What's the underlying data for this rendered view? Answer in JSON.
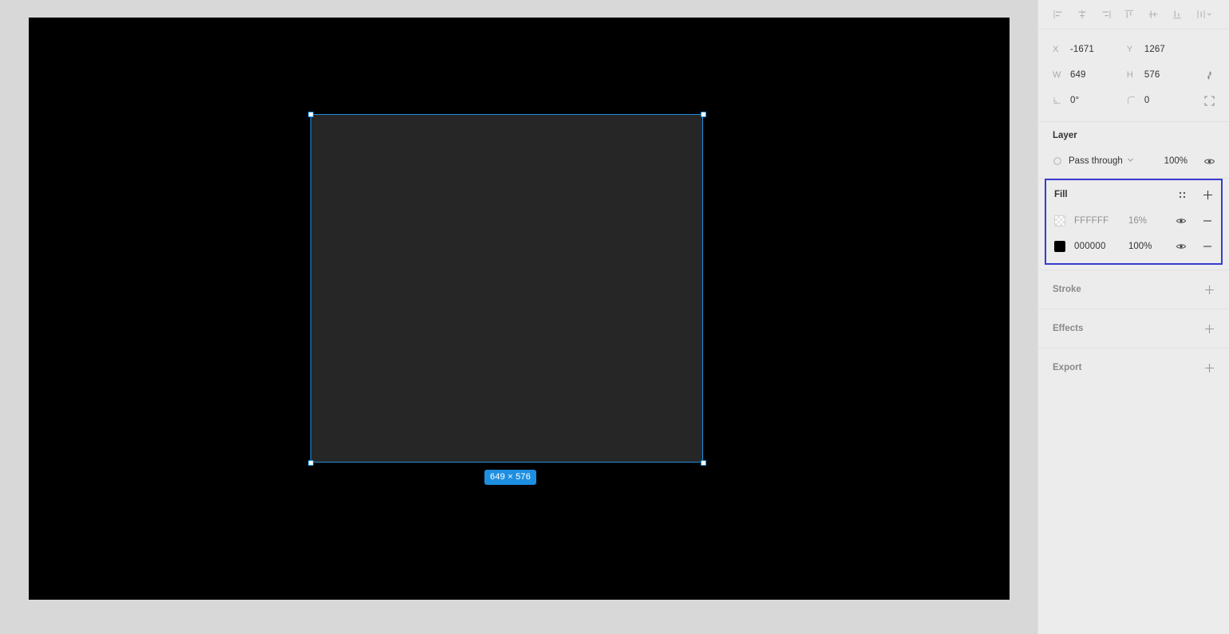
{
  "colors": {
    "page_background": "#d8d8d8",
    "canvas_background": "#000000",
    "panel_background": "#ececec",
    "rect_fill": "#262626",
    "selection_blue": "#1e8fe0",
    "highlight_border": "#3a3ad0",
    "label_gray": "#aaaaaa",
    "text_dark": "#333333"
  },
  "align_toolbar": {
    "items": [
      {
        "name": "align-left-icon",
        "label": "Align left"
      },
      {
        "name": "align-horizontal-center-icon",
        "label": "Align horizontal centers"
      },
      {
        "name": "align-right-icon",
        "label": "Align right"
      },
      {
        "name": "align-top-icon",
        "label": "Align top"
      },
      {
        "name": "align-vertical-center-icon",
        "label": "Align vertical centers"
      },
      {
        "name": "align-bottom-icon",
        "label": "Align bottom"
      },
      {
        "name": "distribute-menu-icon",
        "label": "Distribute"
      }
    ]
  },
  "geometry": {
    "x": {
      "label": "X",
      "value": "-1671"
    },
    "y": {
      "label": "Y",
      "value": "1267"
    },
    "w": {
      "label": "W",
      "value": "649"
    },
    "h": {
      "label": "H",
      "value": "576"
    },
    "rotation": {
      "label": "angle-icon",
      "value": "0°"
    },
    "corner_radius": {
      "label": "corner-radius-icon",
      "value": "0"
    },
    "constrain_proportions_icon": "link-ratio-icon",
    "independent_corners_icon": "independent-corners-icon"
  },
  "layer": {
    "title": "Layer",
    "blend_mode": "Pass through",
    "opacity": "100%",
    "visibility_icon": "eye-icon",
    "blend_icon": "blend-mode-icon",
    "chevron_icon": "chevron-down-icon"
  },
  "fill": {
    "title": "Fill",
    "styles_icon": "style-grid-icon",
    "add_icon": "plus-icon",
    "rows": [
      {
        "swatch": "checkerboard",
        "hex": "FFFFFF",
        "opacity": "16%",
        "visibility_icon": "eye-icon",
        "remove_icon": "minus-icon"
      },
      {
        "swatch": "solid-black",
        "hex": "000000",
        "opacity": "100%",
        "visibility_icon": "eye-icon",
        "remove_icon": "minus-icon"
      }
    ]
  },
  "stroke": {
    "title": "Stroke",
    "add_icon": "plus-icon"
  },
  "effects": {
    "title": "Effects",
    "add_icon": "plus-icon"
  },
  "export": {
    "title": "Export",
    "add_icon": "plus-icon"
  },
  "canvas": {
    "selection": {
      "dimension_badge": "649 × 576",
      "handles": [
        "top-left",
        "top-right",
        "bottom-left",
        "bottom-right"
      ]
    }
  }
}
